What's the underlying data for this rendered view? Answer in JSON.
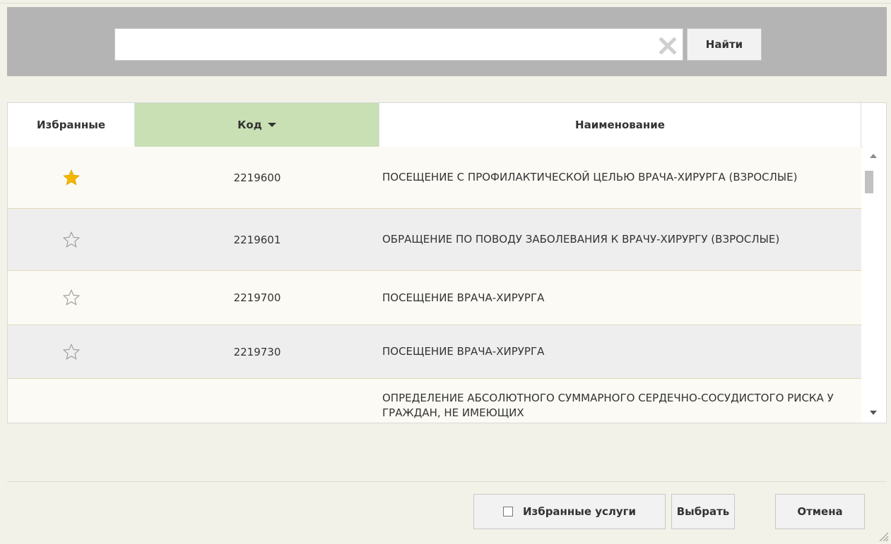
{
  "search": {
    "value": "",
    "placeholder": "",
    "find_label": "Найти"
  },
  "grid": {
    "columns": {
      "favorites": "Избранные",
      "code": "Код",
      "name": "Наименование"
    },
    "sort_column": "code",
    "sort_direction": "descending",
    "rows": [
      {
        "favorite": true,
        "code": "2219600",
        "name": "ПОСЕЩЕНИЕ С ПРОФИЛАКТИЧЕСКОЙ ЦЕЛЬЮ ВРАЧА-ХИРУРГА (ВЗРОСЛЫЕ)"
      },
      {
        "favorite": false,
        "code": "2219601",
        "name": "ОБРАЩЕНИЕ ПО ПОВОДУ ЗАБОЛЕВАНИЯ К ВРАЧУ-ХИРУРГУ (ВЗРОСЛЫЕ)"
      },
      {
        "favorite": false,
        "code": "2219700",
        "name": "ПОСЕЩЕНИЕ ВРАЧА-ХИРУРГА"
      },
      {
        "favorite": false,
        "code": "2219730",
        "name": "ПОСЕЩЕНИЕ ВРАЧА-ХИРУРГА"
      },
      {
        "favorite": false,
        "code": "",
        "name": "ОПРЕДЕЛЕНИЕ АБСОЛЮТНОГО СУММАРНОГО СЕРДЕЧНО-СОСУДИСТОГО РИСКА У ГРАЖДАН, НЕ ИМЕЮЩИХ"
      }
    ]
  },
  "footer": {
    "favorites_toggle_label": "Избранные услуги",
    "favorites_toggle_checked": false,
    "select_label": "Выбрать",
    "cancel_label": "Отмена"
  },
  "colors": {
    "star_active": "#f5b800",
    "star_inactive": "#9a9a9a",
    "sorted_header_bg": "#c8e0b4",
    "search_bar_bg": "#b4b4b4",
    "dialog_bg": "#f3f2e8"
  },
  "icons": {
    "clear": "clear-x-icon",
    "favorite_on": "star-filled-icon",
    "favorite_off": "star-outline-icon",
    "sort": "sort-down-icon"
  }
}
